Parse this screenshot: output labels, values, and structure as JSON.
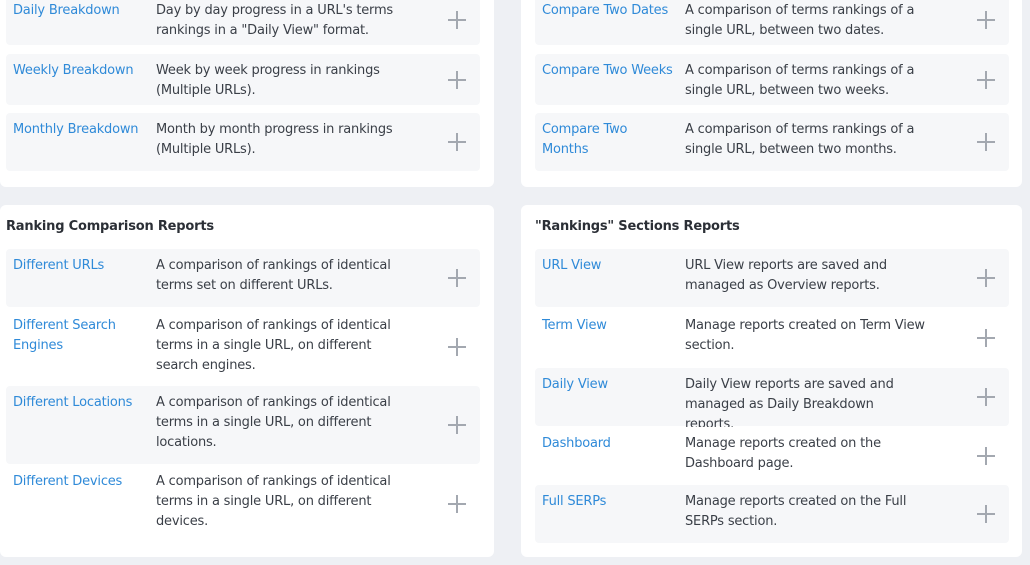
{
  "top_left": {
    "rows": [
      {
        "name": "Daily Breakdown",
        "desc": "Day by day progress in a URL's terms rankings in a \"Daily View\" format."
      },
      {
        "name": "Weekly Breakdown",
        "desc": "Week by week progress in rankings (Multiple URLs)."
      },
      {
        "name": "Monthly Breakdown",
        "desc": "Month by month progress in rankings (Multiple URLs)."
      }
    ]
  },
  "top_right": {
    "rows": [
      {
        "name": "Compare Two Dates",
        "desc": "A comparison of terms rankings of a single URL, between two dates."
      },
      {
        "name": "Compare Two Weeks",
        "desc": "A comparison of terms rankings of a single URL, between two weeks."
      },
      {
        "name": "Compare Two Months",
        "desc": "A comparison of terms rankings of a single URL, between two months."
      }
    ]
  },
  "ranking_comparison": {
    "title": "Ranking Comparison Reports",
    "rows": [
      {
        "name": "Different URLs",
        "desc": "A comparison of rankings of identical terms set on different URLs."
      },
      {
        "name": "Different Search Engines",
        "desc": "A comparison of rankings of identical terms in a single URL, on different search engines."
      },
      {
        "name": "Different Locations",
        "desc": "A comparison of rankings of identical terms in a single URL, on different locations."
      },
      {
        "name": "Different Devices",
        "desc": "A comparison of rankings of identical terms in a single URL, on different devices."
      }
    ]
  },
  "rankings_sections": {
    "title": "\"Rankings\" Sections Reports",
    "rows": [
      {
        "name": "URL View",
        "desc": "URL View reports are saved and managed as Overview reports."
      },
      {
        "name": "Term View",
        "desc": "Manage reports created on Term View section."
      },
      {
        "name": "Daily View",
        "desc": "Daily View reports are saved and managed as Daily Breakdown reports."
      },
      {
        "name": "Dashboard",
        "desc": "Manage reports created on the Dashboard page."
      },
      {
        "name": "Full SERPs",
        "desc": "Manage reports created on the Full SERPs section."
      }
    ]
  },
  "icons": {
    "add": "plus-icon"
  },
  "colors": {
    "link": "#2f8ad8",
    "row_bg": "#f6f7f9",
    "page_bg": "#eef0f4"
  }
}
